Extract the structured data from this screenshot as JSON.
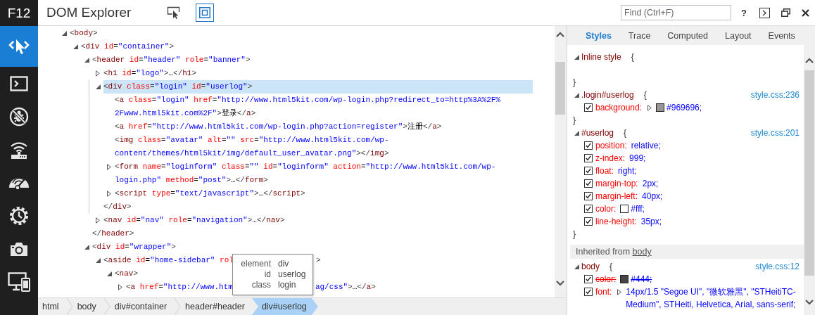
{
  "sidebar": {
    "title": "F12",
    "tools": [
      {
        "kind": "cursor",
        "selected": true
      },
      {
        "kind": "prompt",
        "selected": false
      },
      {
        "kind": "bug",
        "selected": false
      },
      {
        "kind": "router",
        "selected": false
      },
      {
        "kind": "gauge",
        "selected": false
      },
      {
        "kind": "gear-clock",
        "selected": false
      },
      {
        "kind": "camera",
        "selected": false
      },
      {
        "kind": "devices",
        "selected": false
      }
    ]
  },
  "toolbar": {
    "title": "DOM Explorer",
    "tools": [
      {
        "kind": "select",
        "selected": false
      },
      {
        "kind": "highlight",
        "selected": true
      }
    ],
    "find": {
      "placeholder": "Find (Ctrl+F)"
    },
    "help": "?"
  },
  "dom_tree": {
    "nodes": [
      {
        "lines": [
          "<body>"
        ],
        "expanded": true,
        "selected": false,
        "children": [
          {
            "lines": [
              "<div id=\"container\">"
            ],
            "expanded": true,
            "selected": false,
            "children": [
              {
                "lines": [
                  "<header id=\"header\" role=\"banner\">"
                ],
                "expanded": true,
                "selected": false,
                "close": "</header>",
                "children": [
                  {
                    "lines": [
                      "<h1 id=\"logo\">…</h1>"
                    ],
                    "expanded": false,
                    "selected": false
                  },
                  {
                    "lines": [
                      "<div class=\"login\" id=\"userlog\">"
                    ],
                    "expanded": true,
                    "selected": true,
                    "close": "</div>",
                    "children": [
                      {
                        "lines": [
                          "<a class=\"login\" href=\"http://www.html5kit.com/wp-login.php?redirect_to=http%3A%2F%",
                          "2Fwww.html5kit.com%2F\">登录</a>"
                        ],
                        "selected": false
                      },
                      {
                        "lines": [
                          "<a href=\"http://www.html5kit.com/wp-login.php?action=register\">注册</a>"
                        ],
                        "selected": false
                      },
                      {
                        "lines": [
                          "<img class=\"avatar\" alt=\"\" src=\"http://www.html5kit.com/wp-",
                          "content/themes/html5kit/img/default_user_avatar.png\"></img>"
                        ],
                        "selected": false
                      },
                      {
                        "lines": [
                          "<form name=\"loginform\" class=\"\" id=\"loginform\" action=\"http://www.html5kit.com/wp-",
                          "login.php\" method=\"post\">…</form>"
                        ],
                        "expanded": false,
                        "selected": false
                      },
                      {
                        "lines": [
                          "<script type=\"text/javascript\">…</script>"
                        ],
                        "expanded": false,
                        "selected": false
                      }
                    ]
                  },
                  {
                    "lines": [
                      "<nav id=\"nav\" role=\"navigation\">…</nav>"
                    ],
                    "expanded": false,
                    "selected": false
                  }
                ]
              },
              {
                "lines": [
                  "<div id=\"wrapper\">"
                ],
                "expanded": true,
                "selected": false,
                "children": [
                  {
                    "lines": [
                      [
                        "<aside id=\"home-sidebar\" rol",
                        ">"
                      ]
                    ],
                    "expanded": true,
                    "selected": false,
                    "children": [
                      {
                        "lines": [
                          "<nav>"
                        ],
                        "expanded": true,
                        "selected": false,
                        "children": [
                          {
                            "lines": [
                              [
                                "<a href=\"http://www.htm",
                                "ag/css\">…</a>"
                              ]
                            ],
                            "expanded": false,
                            "selected": false
                          }
                        ]
                      }
                    ]
                  }
                ]
              }
            ]
          }
        ]
      }
    ],
    "tooltip": {
      "rows": [
        {
          "label": "element",
          "value": "div"
        },
        {
          "label": "id",
          "value": "userlog"
        },
        {
          "label": "class",
          "value": "login"
        }
      ]
    }
  },
  "breadcrumb": [
    {
      "label": "html",
      "selected": false
    },
    {
      "label": "body",
      "selected": false
    },
    {
      "label": "div#container",
      "selected": false
    },
    {
      "label": "header#header",
      "selected": false
    },
    {
      "label": "div#userlog",
      "selected": true
    }
  ],
  "styles_panel": {
    "tabs": [
      {
        "label": "Styles",
        "selected": true
      },
      {
        "label": "Trace",
        "selected": false
      },
      {
        "label": "Computed",
        "selected": false
      },
      {
        "label": "Layout",
        "selected": false
      },
      {
        "label": "Events",
        "selected": false
      }
    ],
    "rules": [
      {
        "selector": "Inline style",
        "open": "{",
        "close": "}",
        "expanded": true
      },
      {
        "selector": ".login#userlog",
        "open": "{",
        "close": "}",
        "expanded": true,
        "source": "style.css:236",
        "declarations": [
          {
            "property": "background:",
            "value": "#969696;",
            "checked": true,
            "overridden": false,
            "expanded": false,
            "color": "#969696"
          }
        ]
      },
      {
        "selector": "#userlog",
        "open": "{",
        "close": "}",
        "expanded": true,
        "source": "style.css:201",
        "declarations": [
          {
            "property": "position:",
            "value": "relative;",
            "checked": true,
            "overridden": false
          },
          {
            "property": "z-index:",
            "value": "999;",
            "checked": true,
            "overridden": false
          },
          {
            "property": "float:",
            "value": "right;",
            "checked": true,
            "overridden": false
          },
          {
            "property": "margin-top:",
            "value": "2px;",
            "checked": true,
            "overridden": false
          },
          {
            "property": "margin-left:",
            "value": "40px;",
            "checked": true,
            "overridden": false
          },
          {
            "property": "color:",
            "value": "#fff;",
            "checked": true,
            "overridden": false,
            "color": "#ffffff"
          },
          {
            "property": "line-height:",
            "value": "35px;",
            "checked": true,
            "overridden": false
          }
        ]
      }
    ],
    "inherited": {
      "label": "Inherited from",
      "link": "body",
      "rules": [
        {
          "selector": "body",
          "open": "{",
          "expanded": true,
          "source": "style.css:12",
          "declarations": [
            {
              "property": "color:",
              "value": "#444;",
              "checked": true,
              "overridden": true,
              "color": "#444444"
            },
            {
              "property": "font:",
              "value": "14px/1.5 \"Segoe UI\", \"微软雅黑\", \"STHeitiTC-Medium\", STHeiti, Helvetica, Arial, sans-serif;",
              "checked": true,
              "overridden": false,
              "expanded": false
            }
          ]
        }
      ]
    }
  }
}
